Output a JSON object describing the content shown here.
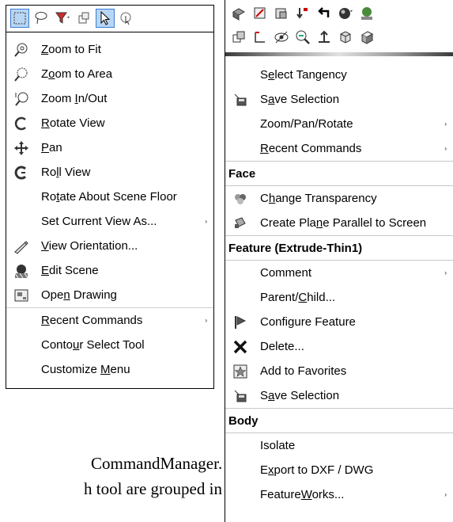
{
  "left_menu": {
    "items": [
      {
        "label": "Zoom to Fit",
        "icon": "zoom-to-fit-icon",
        "arrow": false
      },
      {
        "label": "Zoom to Area",
        "icon": "zoom-to-area-icon",
        "arrow": false
      },
      {
        "label": "Zoom In/Out",
        "icon": "zoom-in-out-icon",
        "arrow": false
      },
      {
        "label": "Rotate View",
        "icon": "rotate-view-icon",
        "arrow": false
      },
      {
        "label": "Pan",
        "icon": "pan-icon",
        "arrow": false
      },
      {
        "label": "Roll View",
        "icon": "roll-view-icon",
        "arrow": false
      },
      {
        "label": "Rotate About Scene Floor",
        "icon": "",
        "arrow": false
      },
      {
        "label": "Set Current View As...",
        "icon": "",
        "arrow": true
      },
      {
        "label": "View Orientation...",
        "icon": "view-orientation-icon",
        "arrow": false
      },
      {
        "label": "Edit Scene",
        "icon": "edit-scene-icon",
        "arrow": false
      },
      {
        "label": "Open Drawing",
        "icon": "open-drawing-icon",
        "arrow": false
      },
      {
        "label": "Recent Commands",
        "icon": "",
        "arrow": true
      },
      {
        "label": "Contour Select Tool",
        "icon": "",
        "arrow": false
      },
      {
        "label": "Customize Menu",
        "icon": "",
        "arrow": false
      }
    ]
  },
  "right_menu": {
    "items_top": [
      {
        "label": "Select Tangency",
        "icon": "",
        "arrow": false
      },
      {
        "label": "Save Selection",
        "icon": "save-selection-icon",
        "arrow": false
      },
      {
        "label": "Zoom/Pan/Rotate",
        "icon": "",
        "arrow": true
      },
      {
        "label": "Recent Commands",
        "icon": "",
        "arrow": true
      }
    ],
    "face_header": "Face",
    "face_items": [
      {
        "label": "Change Transparency",
        "icon": "transparency-icon",
        "arrow": false
      },
      {
        "label": "Create Plane Parallel to Screen",
        "icon": "plane-icon",
        "arrow": false
      }
    ],
    "feature_header": "Feature (Extrude-Thin1)",
    "feature_items": [
      {
        "label": "Comment",
        "icon": "",
        "arrow": true
      },
      {
        "label": "Parent/Child...",
        "icon": "",
        "arrow": false
      },
      {
        "label": "Configure Feature",
        "icon": "configure-feature-icon",
        "arrow": false
      },
      {
        "label": "Delete...",
        "icon": "delete-icon",
        "arrow": false
      },
      {
        "label": "Add to Favorites",
        "icon": "favorites-icon",
        "arrow": false
      },
      {
        "label": "Save Selection",
        "icon": "save-selection-icon",
        "arrow": false
      }
    ],
    "body_header": "Body",
    "body_items": [
      {
        "label": "Isolate",
        "icon": "",
        "arrow": false
      },
      {
        "label": "Export to DXF / DWG",
        "icon": "",
        "arrow": false
      },
      {
        "label": "FeatureWorks...",
        "icon": "",
        "arrow": true
      }
    ]
  },
  "caption": {
    "line1": "CommandManager.",
    "line2": "h tool are grouped in"
  }
}
